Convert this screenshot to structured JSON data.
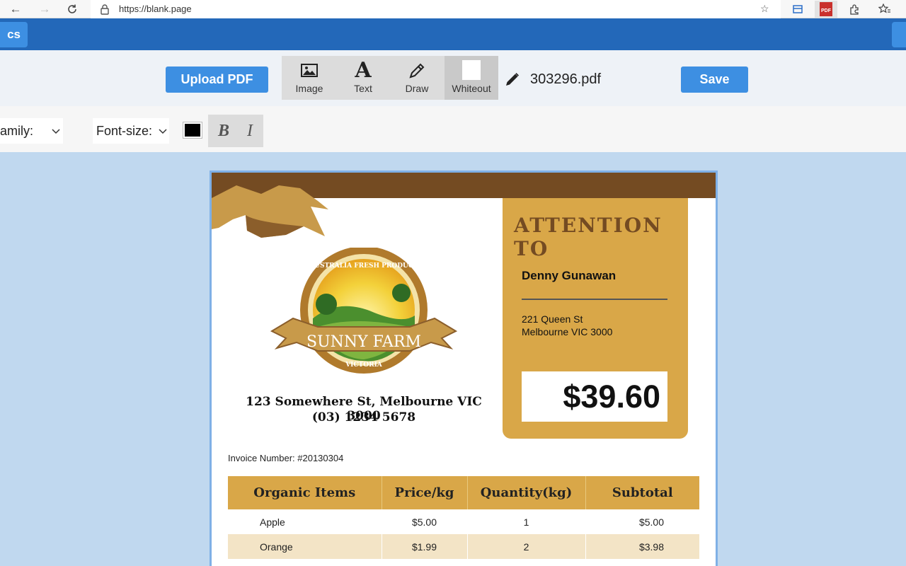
{
  "browser": {
    "url": "https://blank.page"
  },
  "app": {
    "docs_tab_label": "cs"
  },
  "toolbar": {
    "upload_label": "Upload PDF",
    "tools": [
      {
        "label": "Image",
        "icon": "image-icon"
      },
      {
        "label": "Text",
        "icon": "text-icon"
      },
      {
        "label": "Draw",
        "icon": "pencil-icon"
      },
      {
        "label": "Whiteout",
        "icon": "whiteout-icon"
      }
    ],
    "file_name": "303296.pdf",
    "save_label": "Save"
  },
  "format_bar": {
    "font_family_label": "amily:",
    "font_size_label": "Font-size:",
    "color": "#000000",
    "bold_label": "B",
    "italic_label": "I"
  },
  "document": {
    "attention_title": "ATTENTION TO",
    "recipient_name": "Denny Gunawan",
    "address_line1": "221 Queen St",
    "address_line2": "Melbourne VIC 3000",
    "amount": "$39.60",
    "logo_top_text": "AUSTRALIA FRESH PRODUCE",
    "logo_name": "SUNNY FARM",
    "logo_bottom_text": "VICTORIA",
    "farm_address": "123 Somewhere St, Melbourne VIC 3000",
    "farm_phone": "(03) 1234 5678",
    "invoice_number": "Invoice Number: #20130304",
    "table": {
      "headers": [
        "Organic Items",
        "Price/kg",
        "Quantity(kg)",
        "Subtotal"
      ],
      "rows": [
        [
          "Apple",
          "$5.00",
          "1",
          "$5.00"
        ],
        [
          "Orange",
          "$1.99",
          "2",
          "$3.98"
        ]
      ]
    }
  },
  "colors": {
    "app_bar": "#2368b9",
    "accent_button": "#3d8fe2",
    "invoice_gold": "#d9a748",
    "invoice_brown": "#744b22",
    "canvas_bg": "#c0d8ef"
  }
}
